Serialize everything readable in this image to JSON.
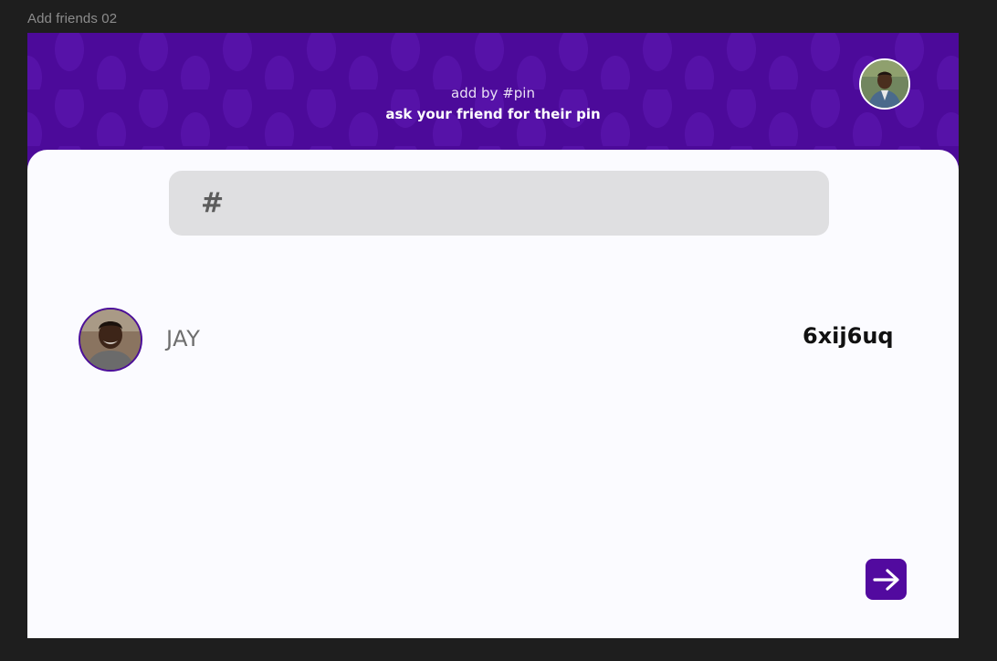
{
  "frame": {
    "label": "Add friends 02"
  },
  "header": {
    "title": "add by #pin",
    "subtitle": "ask your friend for their pin",
    "profile_avatar_icon": "user-avatar"
  },
  "pin_input": {
    "prefix": "#",
    "value": "",
    "placeholder": ""
  },
  "friend": {
    "name": "JAY",
    "pin": "6xij6uq",
    "avatar_icon": "friend-avatar"
  },
  "next_button": {
    "icon": "arrow-right-icon"
  },
  "colors": {
    "header_bg": "#4f0a9e",
    "accent": "#520a9f",
    "card_bg": "#fbfbff",
    "input_bg": "#dfdfe1",
    "canvas_bg": "#1e1e1e"
  }
}
